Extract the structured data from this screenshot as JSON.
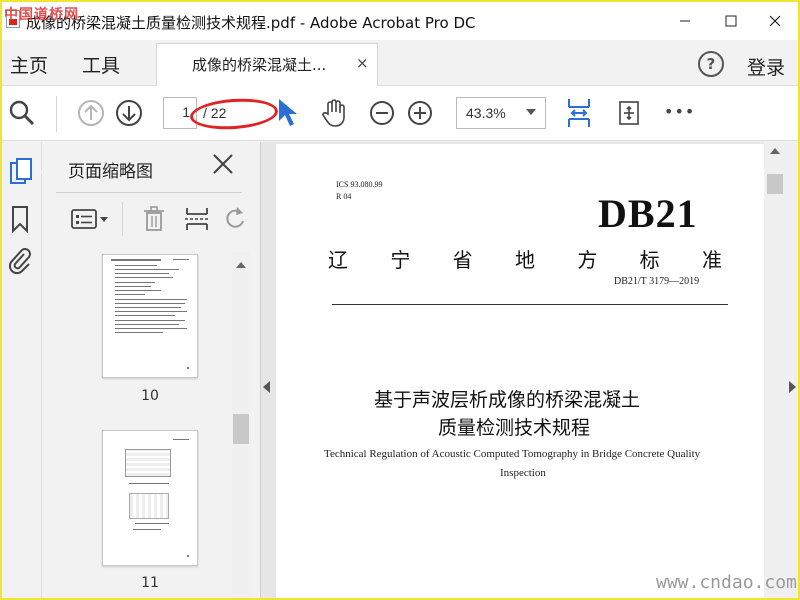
{
  "window": {
    "title": "成像的桥梁混凝土质量检测技术规程.pdf - Adobe Acrobat Pro DC",
    "watermark": "中国道桥网"
  },
  "menu": {
    "home": "主页",
    "tools": "工具",
    "tab_label": "成像的桥梁混凝土...",
    "tab_close": "×",
    "help": "?",
    "login": "登录"
  },
  "toolbar": {
    "current_page": "1",
    "page_total": "/ 22",
    "zoom": "43.3%",
    "more": "•••"
  },
  "thumbnails": {
    "title": "页面缩略图",
    "pages": [
      {
        "number": "10"
      },
      {
        "number": "11"
      }
    ]
  },
  "document": {
    "ics": "ICS 93.080.99",
    "rcode": "R 04",
    "standard_mark": "DB21",
    "standard_type_chars": [
      "辽",
      "宁",
      "省",
      "地",
      "方",
      "标",
      "准"
    ],
    "standard_code": "DB21/T 3179—2019",
    "title_line1": "基于声波层析成像的桥梁混凝土",
    "title_line2": "质量检测技术规程",
    "title_en_line1": "Technical Regulation of Acoustic Computed Tomography in Bridge Concrete Quality",
    "title_en_line2": "Inspection"
  },
  "site_watermark": "www.cndao.com",
  "colors": {
    "accent_blue": "#2b6fd6",
    "annotation_red": "#e02424",
    "frame_yellow": "#f0e531"
  }
}
